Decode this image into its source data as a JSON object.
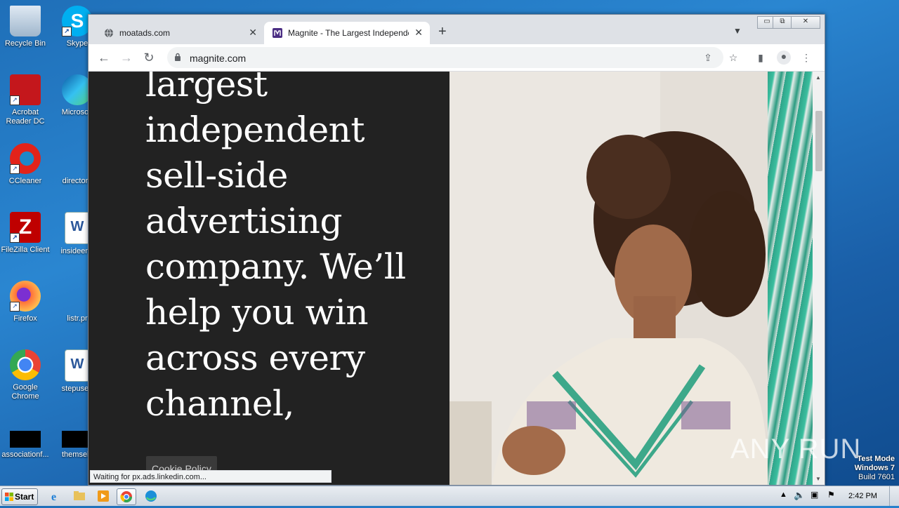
{
  "desktop": {
    "icons": [
      {
        "label": "Recycle Bin"
      },
      {
        "label": "Skype"
      },
      {
        "label": "Acrobat Reader DC"
      },
      {
        "label": "Microsoft"
      },
      {
        "label": "CCleaner"
      },
      {
        "label": "directorn"
      },
      {
        "label": "FileZilla Client"
      },
      {
        "label": "insideenb"
      },
      {
        "label": "Firefox"
      },
      {
        "label": "listr.pr"
      },
      {
        "label": "Google Chrome"
      },
      {
        "label": "stepused"
      },
      {
        "label": "associationf..."
      },
      {
        "label": "themselv"
      }
    ]
  },
  "browser": {
    "tabs": [
      {
        "title": "moatads.com",
        "close": "✕"
      },
      {
        "title": "Magnite - The Largest Independent",
        "close": "✕"
      }
    ],
    "new_tab": "+",
    "address": "magnite.com",
    "window_controls": {
      "minimize": "▭",
      "restore": "⧉",
      "close": "✕"
    }
  },
  "page": {
    "headline": "largest independent sell-side advertising company. We’ll help you win across every channel,",
    "cookie_button": "Cookie Policy",
    "status_text": "Waiting for px.ads.linkedin.com..."
  },
  "taskbar": {
    "start_label": "Start",
    "clock": "2:42 PM"
  },
  "watermark": {
    "line1": "Test Mode",
    "line2": "Windows 7",
    "line3": "Build 7601",
    "brand": "ANY RUN"
  },
  "colors": {
    "page_dark": "#222222",
    "teal_accent": "#2fa389",
    "chrome_frame": "#dee1e6"
  }
}
